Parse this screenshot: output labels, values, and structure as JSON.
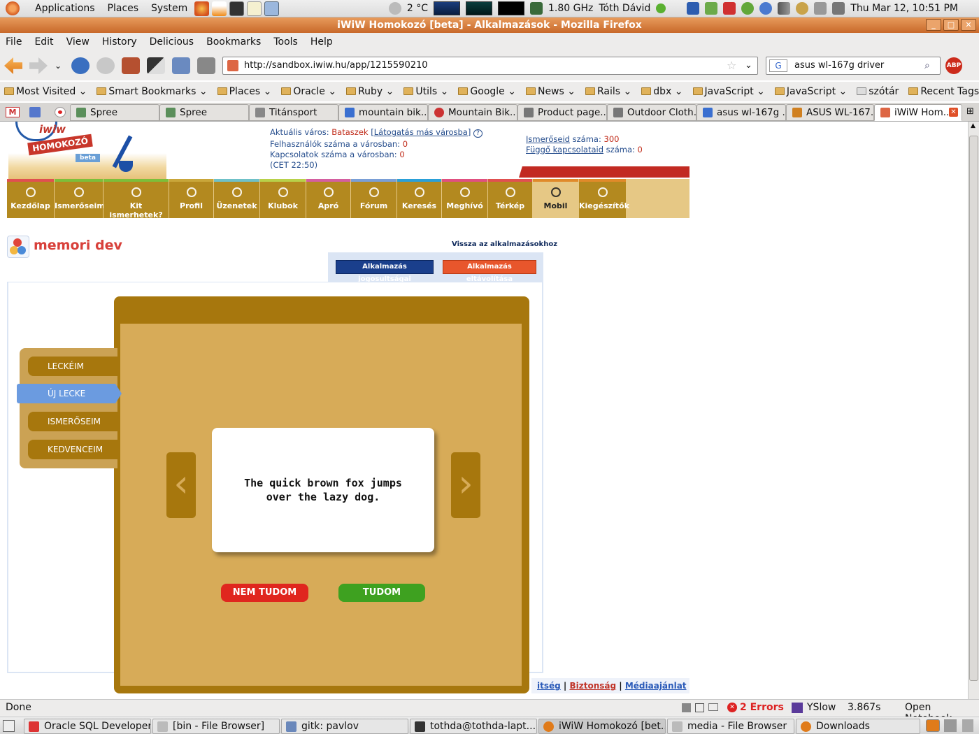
{
  "panel": {
    "menus": [
      "Applications",
      "Places",
      "System"
    ],
    "temperature": "2 °C",
    "cpu_freq": "1.80 GHz",
    "user": "Tóth Dávid",
    "clock": "Thu Mar 12, 10:51 PM"
  },
  "window": {
    "title": "iWiW Homokozó [beta] - Alkalmazások - Mozilla Firefox"
  },
  "menubar": [
    "File",
    "Edit",
    "View",
    "History",
    "Delicious",
    "Bookmarks",
    "Tools",
    "Help"
  ],
  "navbar": {
    "url": "http://sandbox.iwiw.hu/app/1215590210",
    "search_value": "asus wl-167g driver"
  },
  "bookmarks": [
    "Most Visited",
    "Smart Bookmarks",
    "Places",
    "Oracle",
    "Ruby",
    "Utils",
    "Google",
    "News",
    "Rails",
    "dbx",
    "JavaScript",
    "JavaScript",
    "szótár",
    "Recent Tags"
  ],
  "tabs": [
    "Spree",
    "Spree",
    "Titánsport",
    "mountain bik...",
    "Mountain Bik...",
    "Product page...",
    "Outdoor Cloth...",
    "asus wl-167g ...",
    "ASUS WL-167...",
    "iWiW Hom..."
  ],
  "site": {
    "logo_text": "iwiw",
    "logo_sub": "HOMOKOZÓ",
    "logo_badge": "beta",
    "city_label": "Aktuális város:",
    "city_value": "Bataszek",
    "city_link": "[Látogatás más városba]",
    "users_label": "Felhasználók száma a városban:",
    "users_value": "0",
    "conn_label": "Kapcsolatok száma a városban:",
    "conn_value": "0",
    "time": "(CET 22:50)",
    "friends_link": "Ismerőseid",
    "friends_label": "száma:",
    "friends_value": "300",
    "pending_link": "Függő kapcsolataid",
    "pending_label": "száma:",
    "pending_value": "0",
    "nav": [
      "Kezdőlap",
      "Ismerőseim",
      "Kit ismerhetek?",
      "Profil",
      "Üzenetek",
      "Klubok",
      "Apró",
      "Fórum",
      "Keresés",
      "Meghívó",
      "Térkép",
      "Mobil",
      "Kiegészítők"
    ],
    "nav_colors": [
      "#e05050",
      "#7cbf3a",
      "#7cbf3a",
      "#c9a63a",
      "#6fc1c8",
      "#b8d14a",
      "#d45fa0",
      "#7a9fd6",
      "#2aa0d8",
      "#e05080",
      "#e05050",
      "#e08a2a",
      "#e08a2a"
    ]
  },
  "app": {
    "title": "memori dev",
    "back_link": "Vissza az alkalmazásokhoz",
    "perm_button": "Alkalmazás jogosultságai",
    "remove_button": "Alkalmazás eltávolítása",
    "side_menu": [
      "LECKÉIM",
      "ÚJ LECKE",
      "ISMERŐSEIM",
      "KEDVENCEIM"
    ],
    "card_text": "The quick brown fox jumps over the lazy dog.",
    "no_button": "NEM TUDOM",
    "yes_button": "TUDOM",
    "footer_links": [
      "itség",
      "Biztonság",
      "Médiaajánlat"
    ]
  },
  "status": {
    "text": "Done",
    "errors": "2 Errors",
    "yslow": "YSlow",
    "time": "3.867s",
    "notebook": "Open Notebook"
  },
  "taskbar": [
    "Oracle SQL Developer",
    "[bin - File Browser]",
    "gitk: pavlov",
    "tothda@tothda-lapt...",
    "iWiW Homokozó [bet...",
    "media - File Browser",
    "Downloads"
  ]
}
